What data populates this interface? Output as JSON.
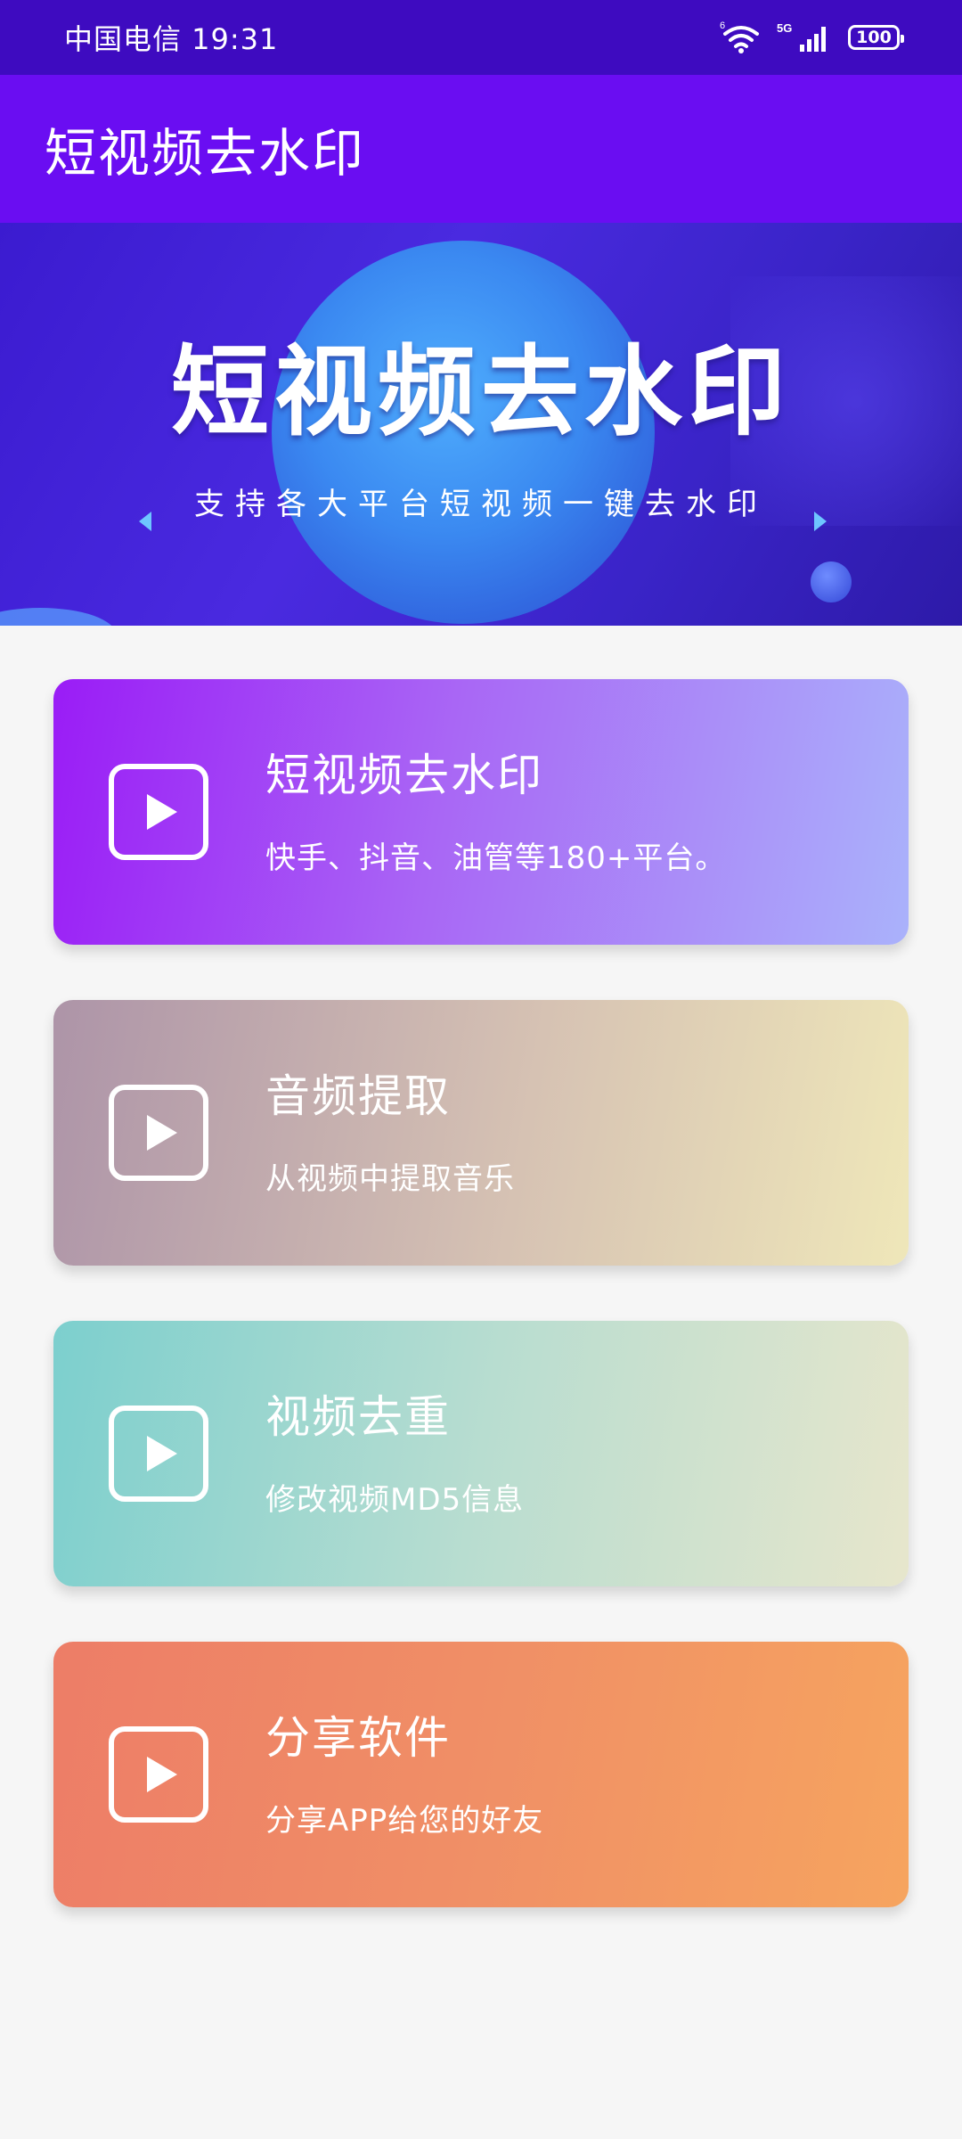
{
  "status_bar": {
    "carrier_time": "中国电信 19:31",
    "wifi_badge": "6",
    "network_badge": "5G",
    "battery": "100"
  },
  "app_bar": {
    "title": "短视频去水印"
  },
  "banner": {
    "title": "短视频去水印",
    "subtitle": "支持各大平台短视频一键去水印"
  },
  "cards": [
    {
      "title": "短视频去水印",
      "desc": "快手、抖音、油管等180+平台。"
    },
    {
      "title": "音频提取",
      "desc": "从视频中提取音乐"
    },
    {
      "title": "视频去重",
      "desc": "修改视频MD5信息"
    },
    {
      "title": "分享软件",
      "desc": "分享APP给您的好友"
    }
  ],
  "colors": {
    "status_bar": "#3e0bc0",
    "app_bar": "#6a0df2",
    "background": "#f6f6f6"
  }
}
